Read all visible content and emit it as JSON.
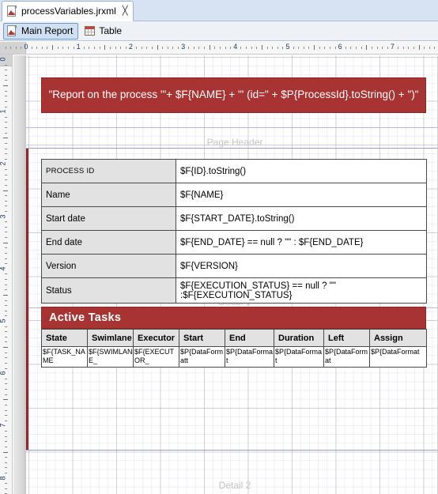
{
  "window": {
    "file_tab": {
      "label": "processVariables.jrxml",
      "close_glyph": "╳",
      "icon": "jrxml-document-icon"
    }
  },
  "view_bar": {
    "buttons": [
      {
        "label": "Main Report",
        "icon": "jrxml-document-icon",
        "selected": true
      },
      {
        "label": "Table",
        "icon": "table-icon",
        "selected": false
      }
    ]
  },
  "rulers": {
    "horizontal": {
      "labels": [
        "0",
        "1",
        "2",
        "3",
        "4",
        "5",
        "6",
        "7"
      ],
      "unit": "inch"
    },
    "vertical": {
      "labels": [
        "0",
        "1",
        "2",
        "3",
        "4",
        "5",
        "6",
        "7",
        "8"
      ],
      "unit": "inch"
    }
  },
  "report": {
    "bands": [
      {
        "name": "Page Header",
        "label": "Page Header"
      },
      {
        "name": "Detail 1",
        "label": "Detail 1"
      },
      {
        "name": "Detail 2",
        "label": "Detail 2"
      }
    ],
    "title_banner": {
      "text": "\"Report on the process '\"+ $F{NAME} + \"' (id=\" + $P{ProcessId}.toString() + \")\"",
      "background": "#a83333",
      "text_color": "#ffffff"
    },
    "fields_table": {
      "rows": [
        {
          "label": "PROCESS ID",
          "expression": "$F{ID}.toString()"
        },
        {
          "label": "Name",
          "expression": "$F{NAME}"
        },
        {
          "label": "Start date",
          "expression": "$F{START_DATE}.toString()"
        },
        {
          "label": "End date",
          "expression": "$F{END_DATE} == null ? \"\" : $F{END_DATE}"
        },
        {
          "label": "Version",
          "expression": "$F{VERSION}"
        },
        {
          "label": "Status",
          "expression": "$F{EXECUTION_STATUS} == null ? \"\" :$F{EXECUTION_STATUS}"
        }
      ]
    },
    "active_tasks": {
      "title": "Active Tasks",
      "columns": [
        "State",
        "Swimlane",
        "Executor",
        "Start",
        "End",
        "Duration",
        "Left",
        "Assign"
      ],
      "cells": [
        "$F{TASK_NAME",
        "$F{SWIMLANE_",
        "$F{EXECUTOR_",
        "$P{DataFormatt",
        "$P{DataFormat",
        "$P{DataFormat",
        "$P{DataFormat",
        "$P{DataFormat"
      ]
    }
  },
  "colors": {
    "accent_red": "#a83333",
    "band_line": "#b9b9dd",
    "label_cell": "#e2e2e2"
  }
}
